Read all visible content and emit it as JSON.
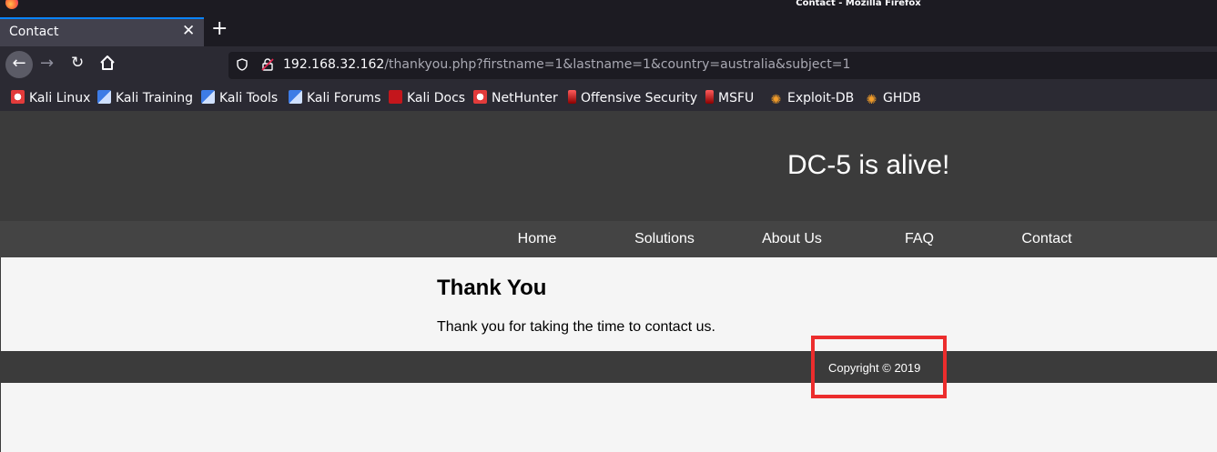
{
  "window": {
    "title": "Contact - Mozilla Firefox"
  },
  "tabs": [
    {
      "label": "Contact"
    }
  ],
  "urlbar": {
    "host": "192.168.32.162",
    "path": "/thankyou.php?firstname=1&lastname=1&country=australia&subject=1"
  },
  "bookmarks": [
    {
      "label": "Kali Linux",
      "icon": "kali-dragon-icon"
    },
    {
      "label": "Kali Training",
      "icon": "kali-training-icon"
    },
    {
      "label": "Kali Tools",
      "icon": "kali-tools-icon"
    },
    {
      "label": "Kali Forums",
      "icon": "kali-forums-icon"
    },
    {
      "label": "Kali Docs",
      "icon": "kali-docs-icon"
    },
    {
      "label": "NetHunter",
      "icon": "nethunter-icon"
    },
    {
      "label": "Offensive Security",
      "icon": "offsec-icon"
    },
    {
      "label": "MSFU",
      "icon": "msfu-icon"
    },
    {
      "label": "Exploit-DB",
      "icon": "exploitdb-icon"
    },
    {
      "label": "GHDB",
      "icon": "ghdb-icon"
    }
  ],
  "site": {
    "title": "DC-5 is alive!",
    "nav": [
      "Home",
      "Solutions",
      "About Us",
      "FAQ",
      "Contact"
    ],
    "heading": "Thank You",
    "message": "Thank you for taking the time to contact us.",
    "footer": "Copyright © 2019"
  },
  "colors": {
    "annotation": "#ec2d2d",
    "header_bg": "#3b3b3b",
    "nav_bg": "#444444",
    "content_bg": "#f5f5f5"
  }
}
